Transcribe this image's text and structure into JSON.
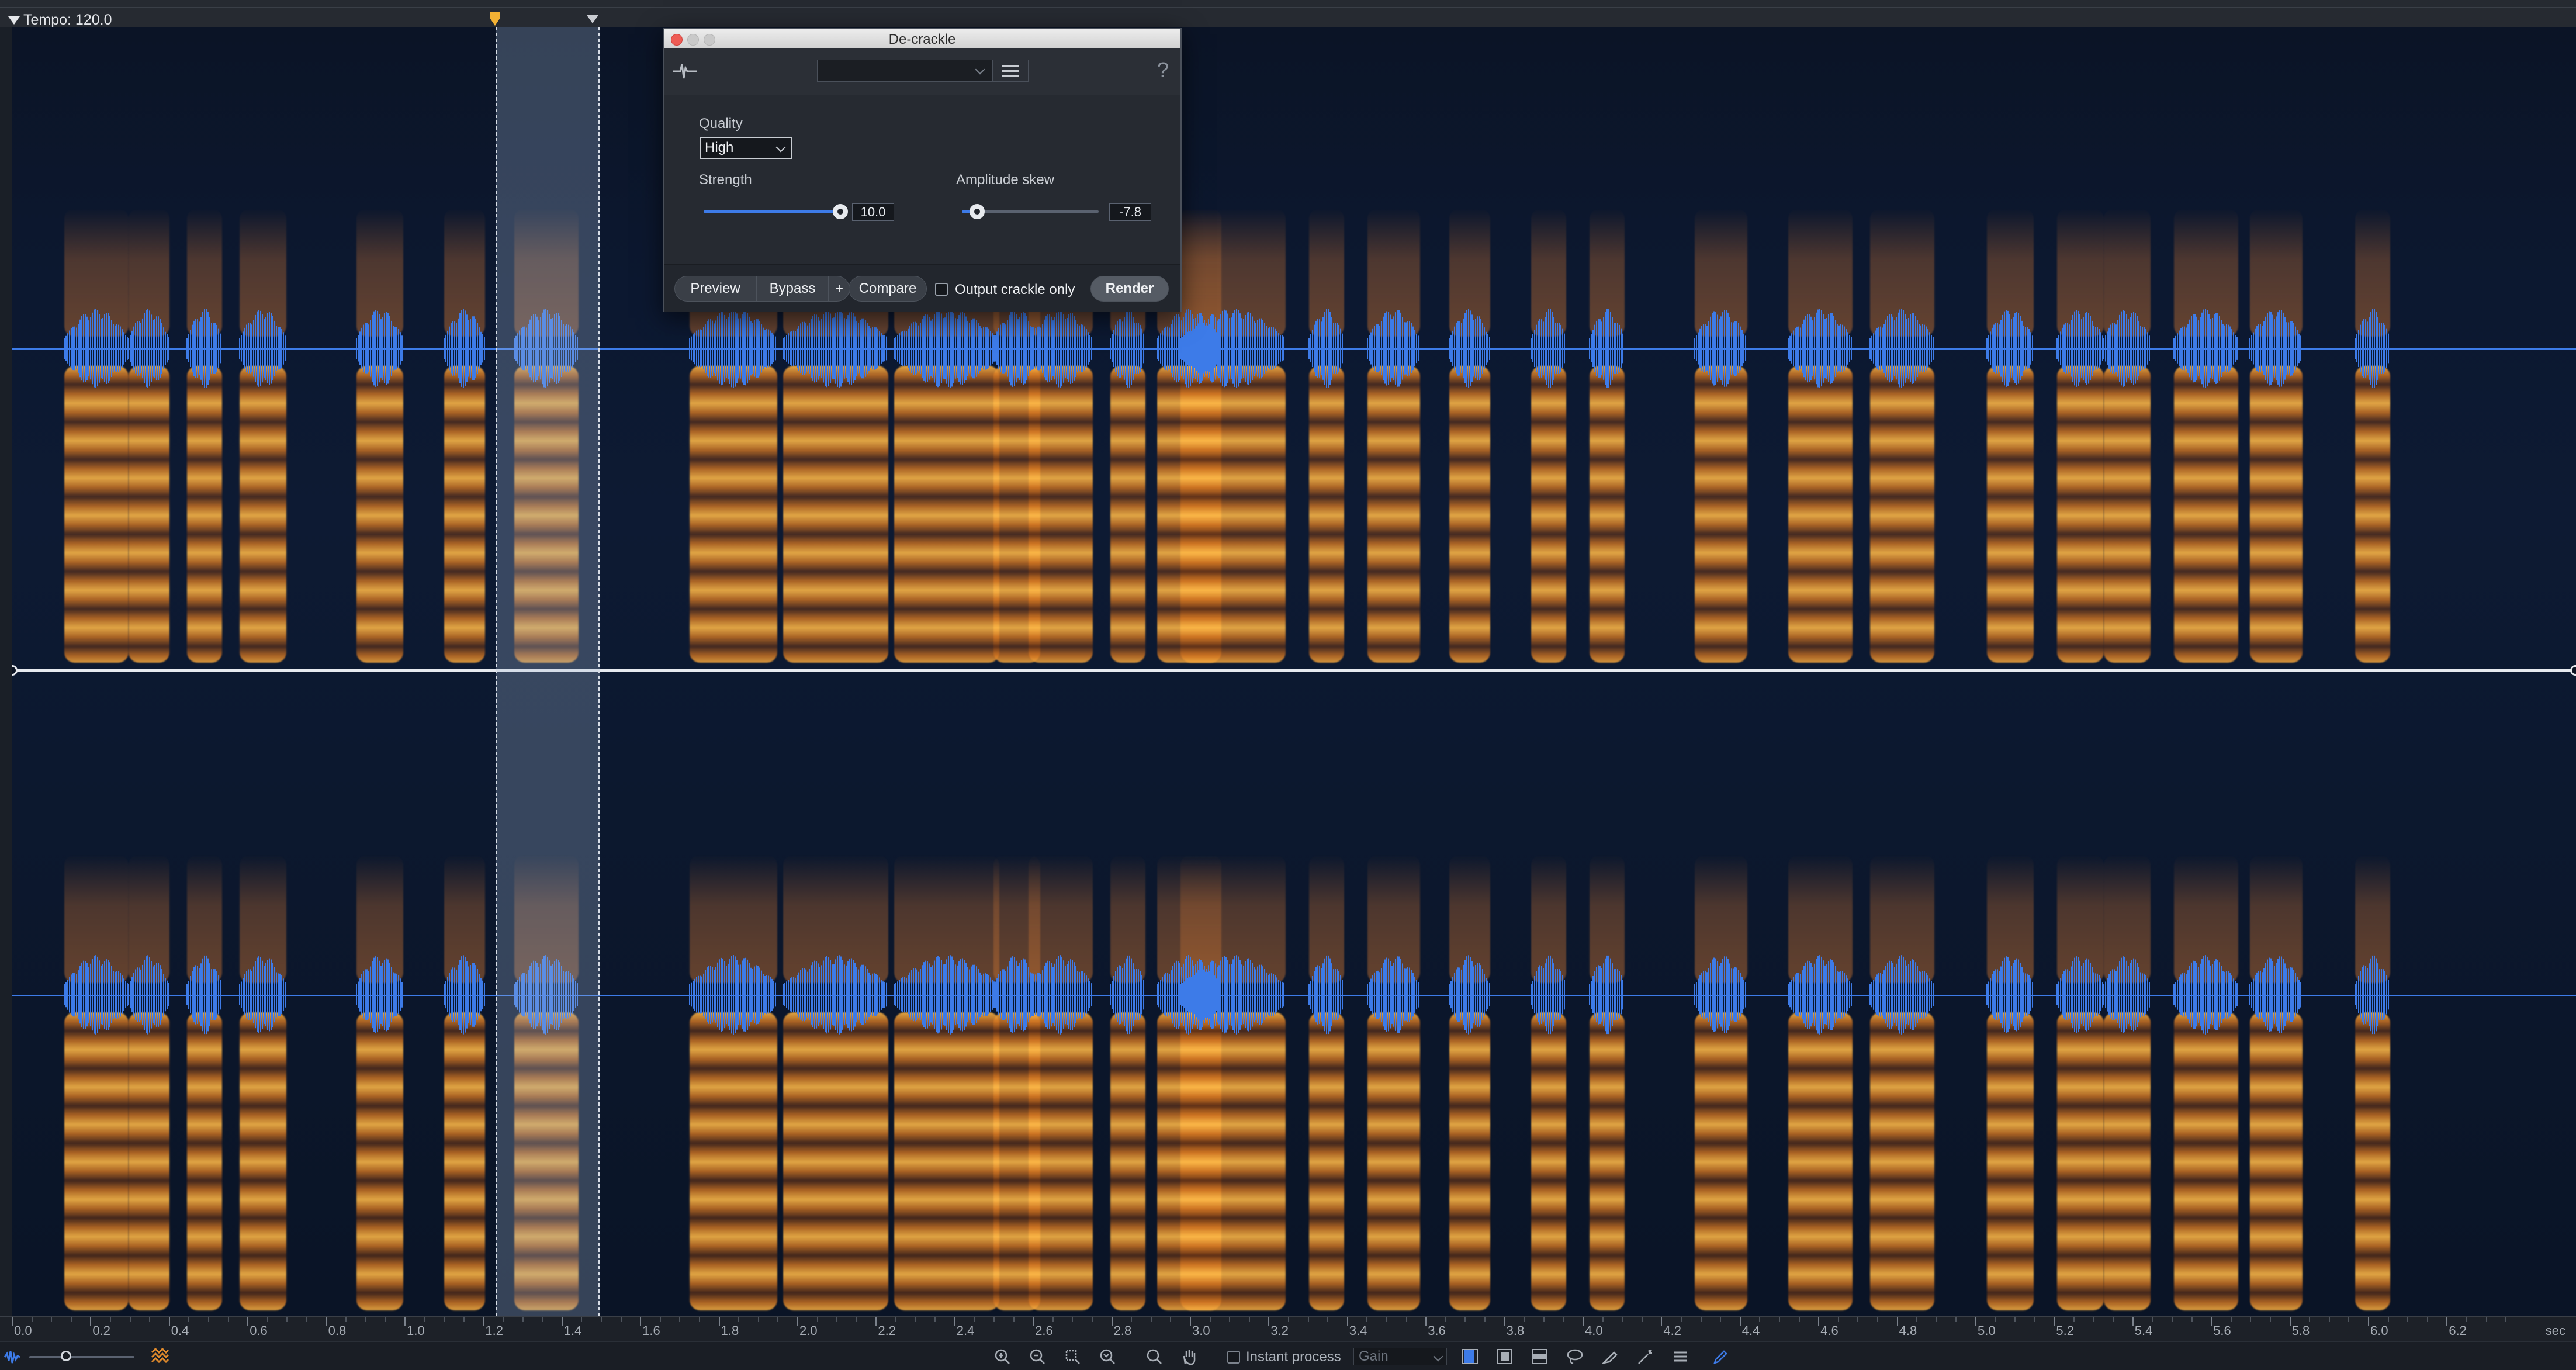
{
  "tempo": {
    "label": "Tempo: 120.0"
  },
  "dialog": {
    "title": "De-crackle",
    "preset_value": "",
    "help_label": "?",
    "quality": {
      "label": "Quality",
      "value": "High"
    },
    "strength": {
      "label": "Strength",
      "value": "10.0",
      "level": 1.0
    },
    "amplitude_skew": {
      "label": "Amplitude skew",
      "value": "-7.8",
      "level": 0.11
    },
    "buttons": {
      "preview": "Preview",
      "bypass": "Bypass",
      "plus": "+",
      "compare": "Compare",
      "output_crackle_only": "Output crackle only",
      "render": "Render"
    }
  },
  "ruler": {
    "labels": [
      "0.0",
      "0.2",
      "0.4",
      "0.6",
      "0.8",
      "1.0",
      "1.2",
      "1.4",
      "1.6",
      "1.8",
      "2.0",
      "2.2",
      "2.4",
      "2.6",
      "2.8",
      "3.0",
      "3.2",
      "3.4",
      "3.6",
      "3.8",
      "4.0",
      "4.2",
      "4.4",
      "4.6",
      "4.8",
      "5.0",
      "5.2",
      "5.4",
      "5.6",
      "5.8",
      "6.0",
      "6.2"
    ],
    "unit": "sec"
  },
  "bottom_toolbar": {
    "instant_process_label": "Instant process",
    "gain_value": "Gain",
    "icons": [
      "zoom-in-icon",
      "zoom-out-icon",
      "zoom-selection-icon",
      "zoom-fit-icon",
      "magnifier-icon",
      "hand-icon",
      "time-selection-icon",
      "time-frequency-selection-icon",
      "frequency-selection-icon",
      "lasso-icon",
      "brush-icon",
      "magic-wand-icon",
      "harmonic-selection-icon",
      "pencil-icon"
    ]
  },
  "colors": {
    "waveform": "#3d7be8",
    "spectrogram_hot": "#ffba48",
    "spectrogram_bg": "#0b1426",
    "selection": "#aabedc"
  }
}
